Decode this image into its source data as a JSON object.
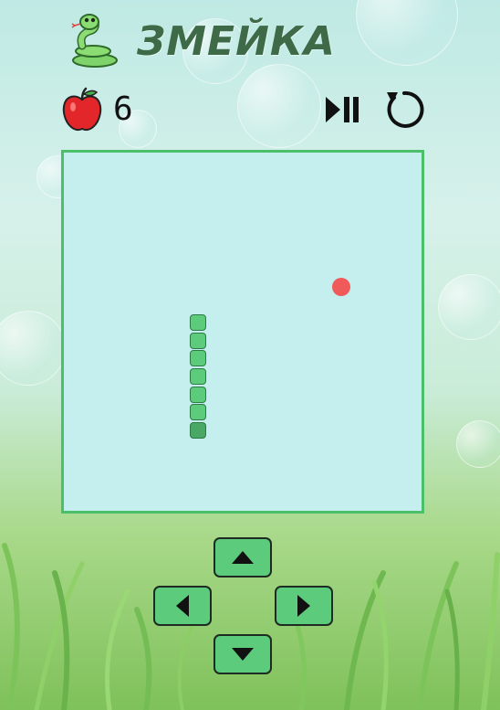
{
  "header": {
    "title": "ЗМЕЙКА",
    "logo_icon": "snake-icon"
  },
  "status": {
    "apple_icon": "apple-icon",
    "score": "6",
    "play_pause_icon": "play-pause-icon",
    "restart_icon": "restart-icon"
  },
  "game": {
    "grid_size": 20,
    "snake_cells": [
      [
        7,
        9
      ],
      [
        7,
        10
      ],
      [
        7,
        11
      ],
      [
        7,
        12
      ],
      [
        7,
        13
      ],
      [
        7,
        14
      ],
      [
        7,
        15
      ]
    ],
    "food_cell": [
      15,
      7
    ],
    "colors": {
      "board": "#c5efee",
      "border": "#4bbf6a",
      "snake": "#5ccc7c",
      "snake_outline": "#2e7a45",
      "food": "#f05a5a"
    }
  },
  "controls": {
    "up_icon": "arrow-up-icon",
    "left_icon": "arrow-left-icon",
    "right_icon": "arrow-right-icon",
    "down_icon": "arrow-down-icon"
  }
}
